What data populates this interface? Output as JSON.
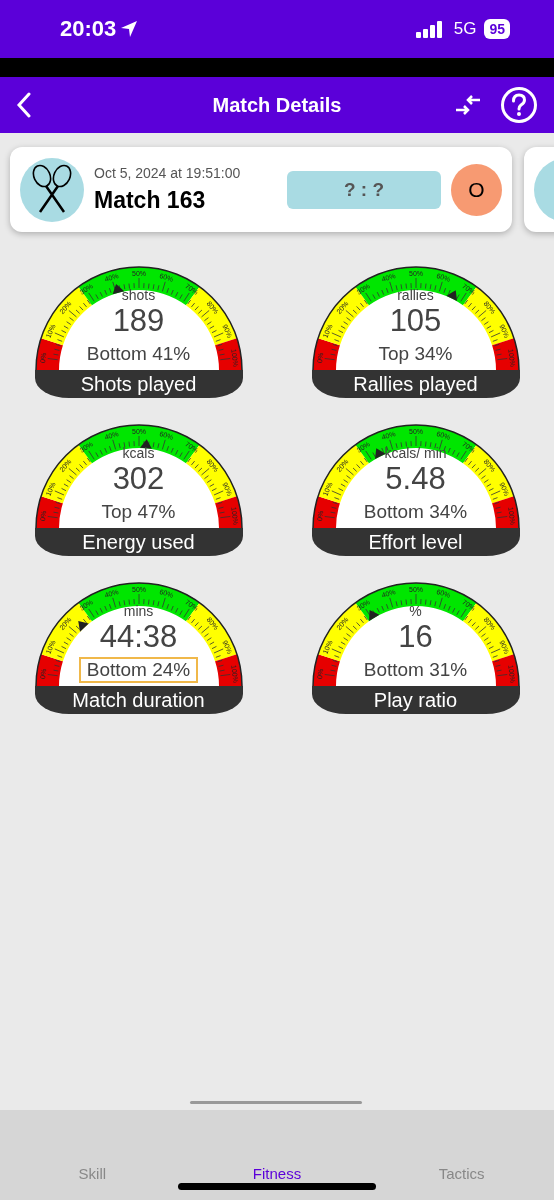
{
  "status_bar": {
    "time": "20:03",
    "network": "5G",
    "battery": "95"
  },
  "nav_bar": {
    "title": "Match Details"
  },
  "match_card": {
    "date": "Oct 5, 2024 at 19:51:00",
    "title": "Match 163",
    "score": "? : ?",
    "opponent_initial": "O"
  },
  "gauges": [
    {
      "unit": "shots",
      "value": "189",
      "percentile": "Bottom 41%",
      "title": "Shots played",
      "level": 0.41,
      "highlighted": false,
      "scale_labels": [
        "0%",
        "10%",
        "20%",
        "30%",
        "40%",
        "50%",
        "60%",
        "70%",
        "80%",
        "90%",
        "100%"
      ]
    },
    {
      "unit": "rallies",
      "value": "105",
      "percentile": "Top 34%",
      "title": "Rallies played",
      "level": 0.66,
      "highlighted": false,
      "scale_labels": [
        "0%",
        "10%",
        "20%",
        "30%",
        "40%",
        "50%",
        "60%",
        "70%",
        "80%",
        "90%",
        "100%"
      ]
    },
    {
      "unit": "kcals",
      "value": "302",
      "percentile": "Top 47%",
      "title": "Energy used",
      "level": 0.53,
      "highlighted": false,
      "scale_labels": [
        "0%",
        "10%",
        "20%",
        "30%",
        "40%",
        "50%",
        "60%",
        "70%",
        "80%",
        "90%",
        "100%"
      ]
    },
    {
      "unit": "kcals/ min",
      "value": "5.48",
      "percentile": "Bottom 34%",
      "title": "Effort level",
      "level": 0.34,
      "highlighted": false,
      "scale_labels": [
        "0%",
        "10%",
        "20%",
        "30%",
        "40%",
        "50%",
        "60%",
        "70%",
        "80%",
        "90%",
        "100%"
      ]
    },
    {
      "unit": "mins",
      "value": "44:38",
      "percentile": "Bottom 24%",
      "title": "Match duration",
      "level": 0.24,
      "highlighted": true,
      "scale_labels": [
        "0%",
        "10%",
        "20%",
        "30%",
        "40%",
        "50%",
        "60%",
        "70%",
        "80%",
        "90%",
        "100%"
      ]
    },
    {
      "unit": "%",
      "value": "16",
      "percentile": "Bottom 31%",
      "title": "Play ratio",
      "level": 0.31,
      "highlighted": false,
      "scale_labels": [
        "0%",
        "10%",
        "20%",
        "30%",
        "40%",
        "50%",
        "60%",
        "70%",
        "80%",
        "90%",
        "100%"
      ]
    }
  ],
  "tab_bar": [
    {
      "label": "Skill",
      "selected": false
    },
    {
      "label": "Fitness",
      "selected": true
    },
    {
      "label": "Tactics",
      "selected": false
    }
  ]
}
